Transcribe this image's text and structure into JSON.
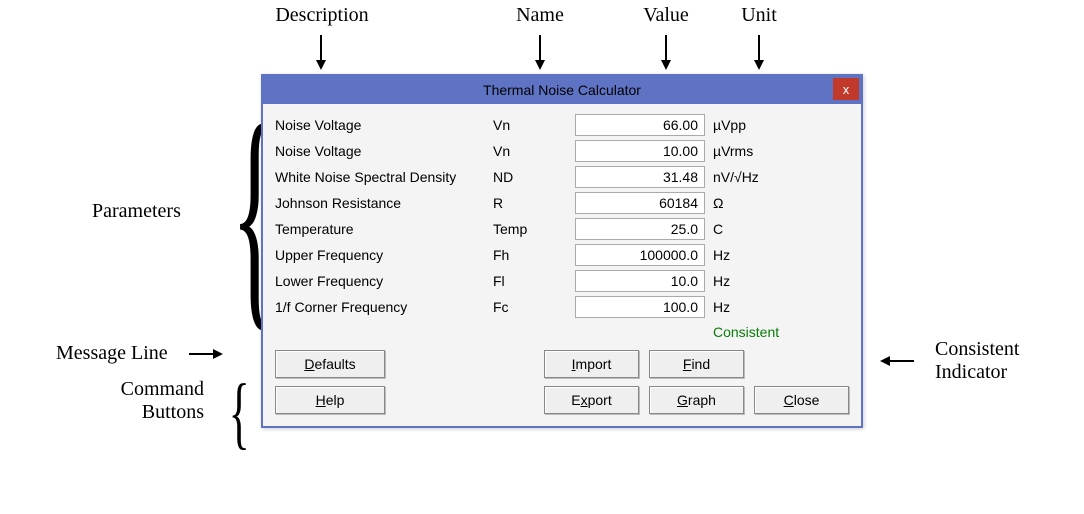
{
  "annotations": {
    "description": "Description",
    "name": "Name",
    "value": "Value",
    "unit": "Unit",
    "parameters": "Parameters",
    "message_line": "Message Line",
    "command_buttons_1": "Command",
    "command_buttons_2": "Buttons",
    "consistent_indicator_1": "Consistent",
    "consistent_indicator_2": "Indicator"
  },
  "window": {
    "title": "Thermal Noise Calculator",
    "close_x": "x",
    "status": "Consistent",
    "status_color": "#0a7a0a",
    "rows": [
      {
        "desc": "Noise Voltage",
        "name": "Vn",
        "value": "66.00",
        "unit": "µVpp"
      },
      {
        "desc": "Noise Voltage",
        "name": "Vn",
        "value": "10.00",
        "unit": "µVrms"
      },
      {
        "desc": "White Noise Spectral Density",
        "name": "ND",
        "value": "31.48",
        "unit": "nV/√Hz"
      },
      {
        "desc": "Johnson Resistance",
        "name": "R",
        "value": "60184",
        "unit": "Ω"
      },
      {
        "desc": "Temperature",
        "name": "Temp",
        "value": "25.0",
        "unit": "C"
      },
      {
        "desc": "Upper Frequency",
        "name": "Fh",
        "value": "100000.0",
        "unit": "Hz"
      },
      {
        "desc": "Lower Frequency",
        "name": "Fl",
        "value": "10.0",
        "unit": "Hz"
      },
      {
        "desc": "1/f Corner Frequency",
        "name": "Fc",
        "value": "100.0",
        "unit": "Hz"
      }
    ],
    "buttons": {
      "defaults": "Defaults",
      "help": "Help",
      "import": "Import",
      "export": "Export",
      "find": "Find",
      "graph": "Graph",
      "close": "Close"
    }
  }
}
